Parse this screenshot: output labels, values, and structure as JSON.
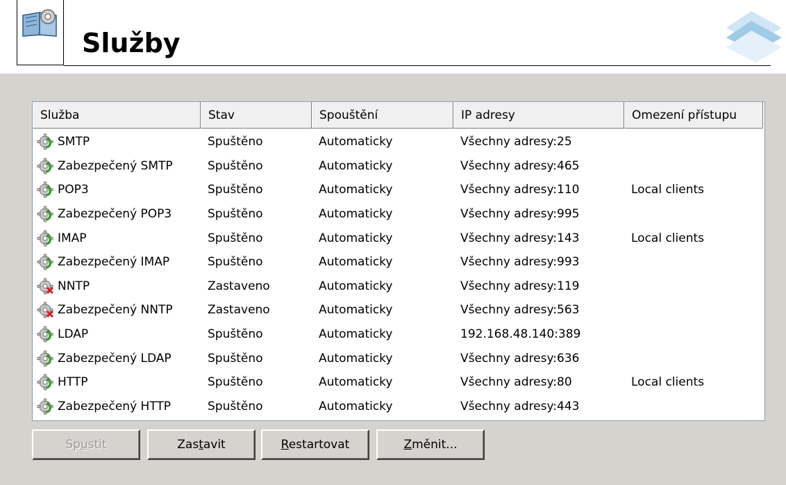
{
  "header": {
    "title": "Služby"
  },
  "table": {
    "columns": [
      {
        "label": "Služba"
      },
      {
        "label": "Stav"
      },
      {
        "label": "Spouštění"
      },
      {
        "label": "IP adresy"
      },
      {
        "label": "Omezení přístupu"
      }
    ],
    "rows": [
      {
        "icon": "service-running-icon",
        "name": "SMTP",
        "status": "Spuštěno",
        "startup": "Automaticky",
        "ip": "Všechny adresy:25",
        "access": ""
      },
      {
        "icon": "service-running-icon",
        "name": "Zabezpečený SMTP",
        "status": "Spuštěno",
        "startup": "Automaticky",
        "ip": "Všechny adresy:465",
        "access": ""
      },
      {
        "icon": "service-running-icon",
        "name": "POP3",
        "status": "Spuštěno",
        "startup": "Automaticky",
        "ip": "Všechny adresy:110",
        "access": "Local clients"
      },
      {
        "icon": "service-running-icon",
        "name": "Zabezpečený POP3",
        "status": "Spuštěno",
        "startup": "Automaticky",
        "ip": "Všechny adresy:995",
        "access": ""
      },
      {
        "icon": "service-running-icon",
        "name": "IMAP",
        "status": "Spuštěno",
        "startup": "Automaticky",
        "ip": "Všechny adresy:143",
        "access": "Local clients"
      },
      {
        "icon": "service-running-icon",
        "name": "Zabezpečený IMAP",
        "status": "Spuštěno",
        "startup": "Automaticky",
        "ip": "Všechny adresy:993",
        "access": ""
      },
      {
        "icon": "service-stopped-icon",
        "name": "NNTP",
        "status": "Zastaveno",
        "startup": "Automaticky",
        "ip": "Všechny adresy:119",
        "access": ""
      },
      {
        "icon": "service-stopped-icon",
        "name": "Zabezpečený NNTP",
        "status": "Zastaveno",
        "startup": "Automaticky",
        "ip": "Všechny adresy:563",
        "access": ""
      },
      {
        "icon": "service-running-icon",
        "name": "LDAP",
        "status": "Spuštěno",
        "startup": "Automaticky",
        "ip": "192.168.48.140:389",
        "access": ""
      },
      {
        "icon": "service-running-icon",
        "name": "Zabezpečený LDAP",
        "status": "Spuštěno",
        "startup": "Automaticky",
        "ip": "Všechny adresy:636",
        "access": ""
      },
      {
        "icon": "service-running-icon",
        "name": "HTTP",
        "status": "Spuštěno",
        "startup": "Automaticky",
        "ip": "Všechny adresy:80",
        "access": "Local clients"
      },
      {
        "icon": "service-running-icon",
        "name": "Zabezpečený HTTP",
        "status": "Spuštěno",
        "startup": "Automaticky",
        "ip": "Všechny adresy:443",
        "access": ""
      }
    ]
  },
  "buttons": {
    "start": {
      "pre": "Sp",
      "key": "u",
      "post": "stit",
      "enabled": false
    },
    "stop": {
      "pre": "Zas",
      "key": "t",
      "post": "avit",
      "enabled": true
    },
    "restart": {
      "pre": "",
      "key": "R",
      "post": "estartovat",
      "enabled": true
    },
    "edit": {
      "pre": "",
      "key": "Z",
      "post": "měnit...",
      "enabled": true
    }
  },
  "colors": {
    "panel": "#d6d3ce",
    "running": "#3a9a2a",
    "stopped": "#d81e1e"
  }
}
